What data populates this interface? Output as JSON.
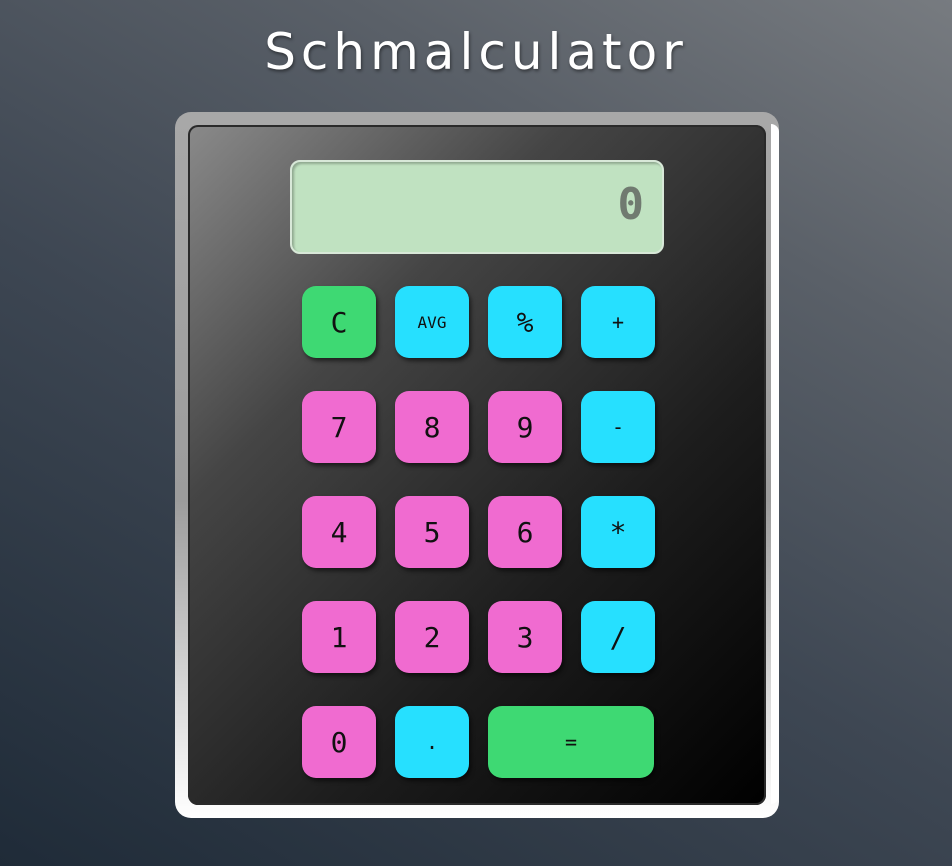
{
  "app": {
    "title": "Schmalculator"
  },
  "display": {
    "value": "0"
  },
  "colors": {
    "number": "#f06bd0",
    "operator": "#26e0ff",
    "action": "#3ed973",
    "display": "#c0e2c1"
  },
  "buttons": {
    "clear": "C",
    "avg": "AVG",
    "percent": "%",
    "add": "+",
    "seven": "7",
    "eight": "8",
    "nine": "9",
    "subtract": "-",
    "four": "4",
    "five": "5",
    "six": "6",
    "multiply": "*",
    "one": "1",
    "two": "2",
    "three": "3",
    "divide": "/",
    "zero": "0",
    "decimal": ".",
    "equals": "="
  }
}
